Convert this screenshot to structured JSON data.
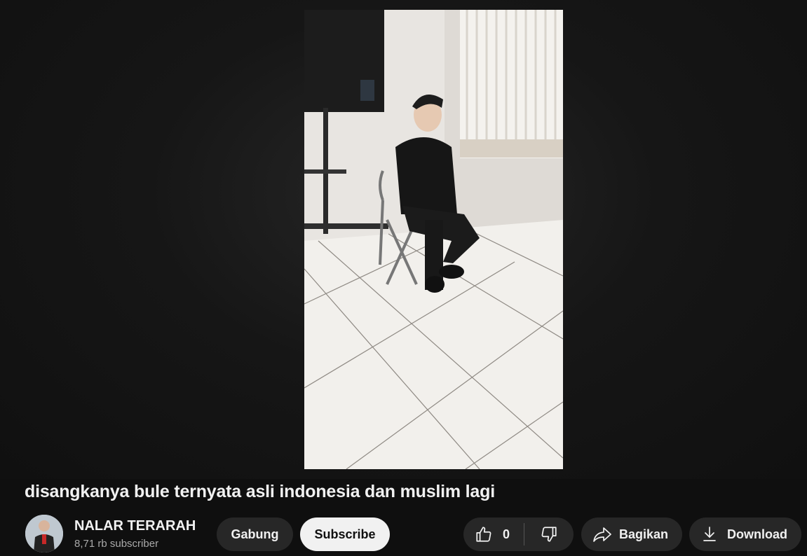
{
  "video": {
    "title": "disangkanya bule ternyata asli indonesia dan muslim lagi"
  },
  "channel": {
    "name": "NALAR TERARAH",
    "subscribers": "8,71 rb subscriber"
  },
  "actions": {
    "join_label": "Gabung",
    "subscribe_label": "Subscribe",
    "like_count": "0",
    "share_label": "Bagikan",
    "download_label": "Download"
  },
  "icons": {
    "like": "thumbs-up-icon",
    "dislike": "thumbs-down-icon",
    "share": "share-arrow-icon",
    "download": "download-icon"
  },
  "colors": {
    "background": "#0f0f0f",
    "pill": "#272727",
    "subscribe_bg": "#f1f1f1",
    "text": "#f1f1f1",
    "secondary_text": "#aaaaaa"
  }
}
